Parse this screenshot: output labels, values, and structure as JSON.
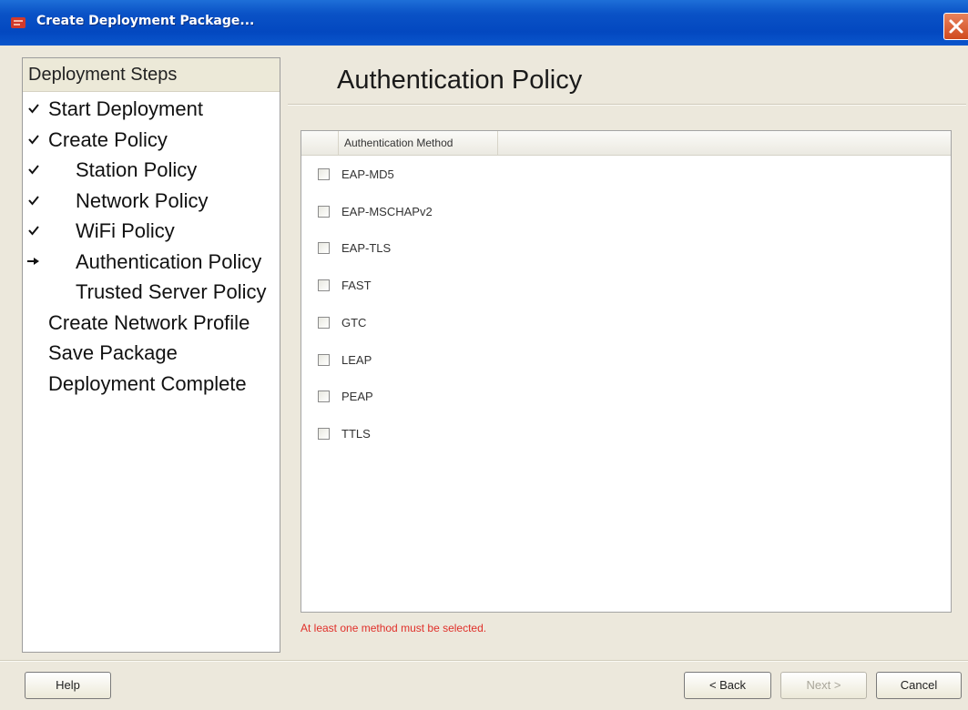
{
  "window": {
    "title": "Create Deployment Package..."
  },
  "steps": {
    "header": "Deployment Steps",
    "items": [
      {
        "label": "Start Deployment",
        "status": "done",
        "indent": 0
      },
      {
        "label": "Create Policy",
        "status": "done",
        "indent": 0
      },
      {
        "label": "Station Policy",
        "status": "done",
        "indent": 1
      },
      {
        "label": "Network Policy",
        "status": "done",
        "indent": 1
      },
      {
        "label": "WiFi Policy",
        "status": "done",
        "indent": 1
      },
      {
        "label": "Authentication Policy",
        "status": "current",
        "indent": 1
      },
      {
        "label": "Trusted Server Policy",
        "status": "pending",
        "indent": 1
      },
      {
        "label": "Create Network Profile",
        "status": "pending",
        "indent": 0
      },
      {
        "label": "Save Package",
        "status": "pending",
        "indent": 0
      },
      {
        "label": "Deployment Complete",
        "status": "pending",
        "indent": 0
      }
    ]
  },
  "main": {
    "title": "Authentication Policy",
    "list_header": "Authentication Method",
    "methods": [
      {
        "label": "EAP-MD5",
        "checked": false
      },
      {
        "label": "EAP-MSCHAPv2",
        "checked": false
      },
      {
        "label": "EAP-TLS",
        "checked": false
      },
      {
        "label": "FAST",
        "checked": false
      },
      {
        "label": "GTC",
        "checked": false
      },
      {
        "label": "LEAP",
        "checked": false
      },
      {
        "label": "PEAP",
        "checked": false
      },
      {
        "label": "TTLS",
        "checked": false
      }
    ],
    "warning": "At least one method must be selected."
  },
  "buttons": {
    "help": "Help",
    "back": "< Back",
    "next": "Next >",
    "cancel": "Cancel"
  },
  "colors": {
    "titlebar": "#0348c0",
    "warning": "#e0302a",
    "dialog_bg": "#ece8dc"
  }
}
